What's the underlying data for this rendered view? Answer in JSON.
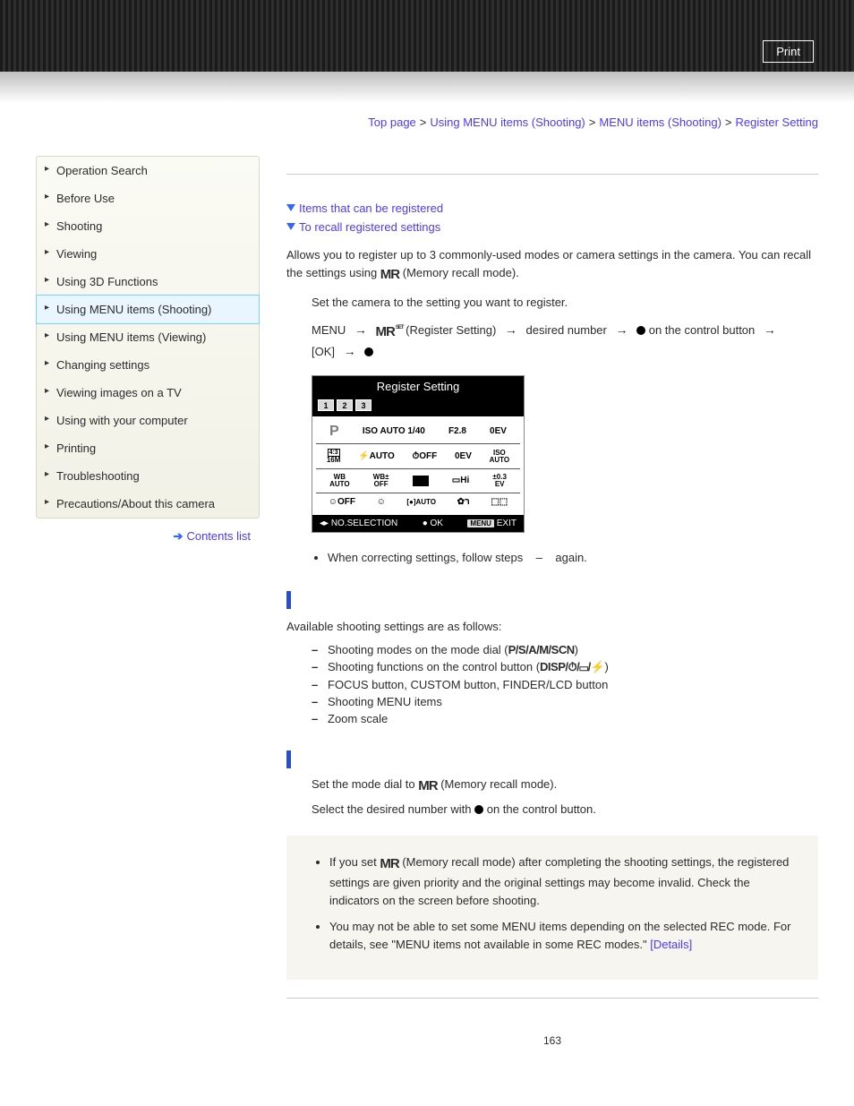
{
  "header": {
    "print": "Print"
  },
  "breadcrumb": {
    "top": "Top page",
    "a": "Using MENU items (Shooting)",
    "b": "MENU items (Shooting)",
    "current": "Register Setting"
  },
  "sidebar": {
    "items": [
      "Operation Search",
      "Before Use",
      "Shooting",
      "Viewing",
      "Using 3D Functions",
      "Using MENU items (Shooting)",
      "Using MENU items (Viewing)",
      "Changing settings",
      "Viewing images on a TV",
      "Using with your computer",
      "Printing",
      "Troubleshooting",
      "Precautions/About this camera"
    ],
    "active_index": 5,
    "contents": "Contents list"
  },
  "anchors": {
    "a1": "Items that can be registered",
    "a2": "To recall registered settings"
  },
  "intro": {
    "p1a": "Allows you to register up to 3 commonly-used modes or camera settings in the camera. You can recall the settings using ",
    "p1b": " (Memory recall mode).",
    "step_set": "Set the camera to the setting you want to register.",
    "menu_label": "MENU",
    "reg_label": " (Register Setting) ",
    "desired": " desired number ",
    "on_ctrl": " on the control button ",
    "ok": "[OK] "
  },
  "screenshot": {
    "title": "Register Setting",
    "tabs": [
      "1",
      "2",
      "3"
    ],
    "r1": {
      "c1": "P",
      "c2": "ISO AUTO 1/40",
      "c3": "F2.8",
      "c4": "0EV"
    },
    "r2": {
      "c1a": "4:3",
      "c1b": "16M",
      "c2": "⚡AUTO",
      "c3": "⏱OFF",
      "c4": "0EV",
      "c5a": "ISO",
      "c5b": "AUTO"
    },
    "r3": {
      "c1a": "WB",
      "c1b": "AUTO",
      "c2a": "WB±",
      "c2b": "OFF",
      "c3": "▭",
      "c4": "▭Hi",
      "c5a": "±0.3",
      "c5b": "EV"
    },
    "r4": {
      "c1": "☺OFF",
      "c2": "☺",
      "c3": "[●]AUTO",
      "c4": "✿רּ",
      "c5": "⬚⬚"
    },
    "footer": {
      "sel": "◂▸ NO.SELECTION",
      "ok": "● OK",
      "menu": "MENU",
      "exit": "EXIT"
    }
  },
  "note1": {
    "a": "When correcting settings, follow steps ",
    "b": " – ",
    "c": " again."
  },
  "section_items": {
    "lead": "Available shooting settings are as follows:",
    "li1a": "Shooting modes on the mode dial (",
    "li1b": ")",
    "li2a": "Shooting functions on the control button (",
    "li2b": ")",
    "li3": "FOCUS button, CUSTOM button, FINDER/LCD button",
    "li4": "Shooting MENU items",
    "li5": "Zoom scale"
  },
  "dial_icons": "P/S/A/M/SCN",
  "ctrl_icons": "DISP/⏱/▭/⚡",
  "section_recall": {
    "s1a": "Set the mode dial to ",
    "s1b": " (Memory recall mode).",
    "s2a": "Select the desired number with ",
    "s2b": " on the control button."
  },
  "notes_box": {
    "n1a": "If you set ",
    "n1b": " (Memory recall mode) after completing the shooting settings, the registered settings are given priority and the original settings may become invalid. Check the indicators on the screen before shooting.",
    "n2a": "You may not be able to set some MENU items depending on the selected REC mode. For details, see \"MENU items not available in some REC modes.\" ",
    "details": "[Details]"
  },
  "mr_glyph": "MR",
  "page_number": "163"
}
